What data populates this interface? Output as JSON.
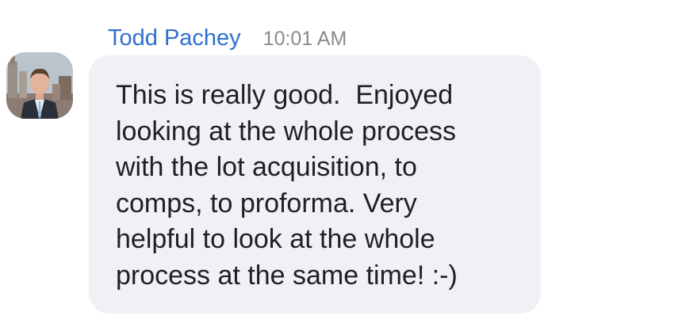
{
  "message": {
    "sender": "Todd Pachey",
    "time": "10:01 AM",
    "avatar": "sender-avatar-photo",
    "lines": [
      "This is really good.  Enjoyed",
      "looking at the whole process",
      "with the lot acquisition, to",
      "comps, to proforma. Very",
      "helpful to look at the whole",
      "process at the same time! :-)"
    ]
  },
  "colors": {
    "sender_name": "#2f6fd0",
    "timestamp": "#8a8a90",
    "bubble_background": "#f0f0f5",
    "message_text": "#1f1f24"
  }
}
